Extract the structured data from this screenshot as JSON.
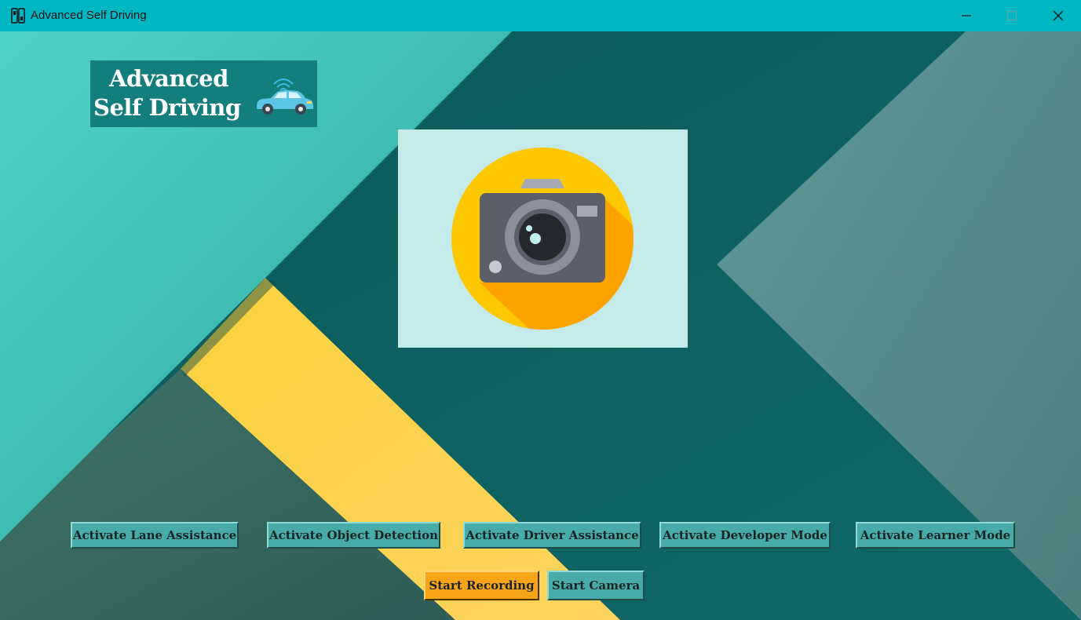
{
  "window": {
    "title": "Advanced Self Driving",
    "minimize_symbol": "—",
    "maximize_symbol": "☐",
    "close_symbol": "✕",
    "app_icon": "app-icon"
  },
  "logo": {
    "line1": "Advanced",
    "line2": "Self Driving",
    "icon": "connected-car-icon"
  },
  "camera_panel": {
    "icon": "camera-icon"
  },
  "mode_buttons": [
    {
      "label": "Activate Lane Assistance"
    },
    {
      "label": "Activate Object Detection"
    },
    {
      "label": "Activate Driver Assistance"
    },
    {
      "label": "Activate Developer Mode"
    },
    {
      "label": "Activate Learner Mode"
    }
  ],
  "action_buttons": {
    "start_recording": "Start Recording",
    "start_camera": "Start Camera"
  },
  "colors": {
    "titlebar": "#00b8c4",
    "button_teal": "#47aca8",
    "button_orange": "#f7a416",
    "accent_yellow": "#fdd24f"
  }
}
